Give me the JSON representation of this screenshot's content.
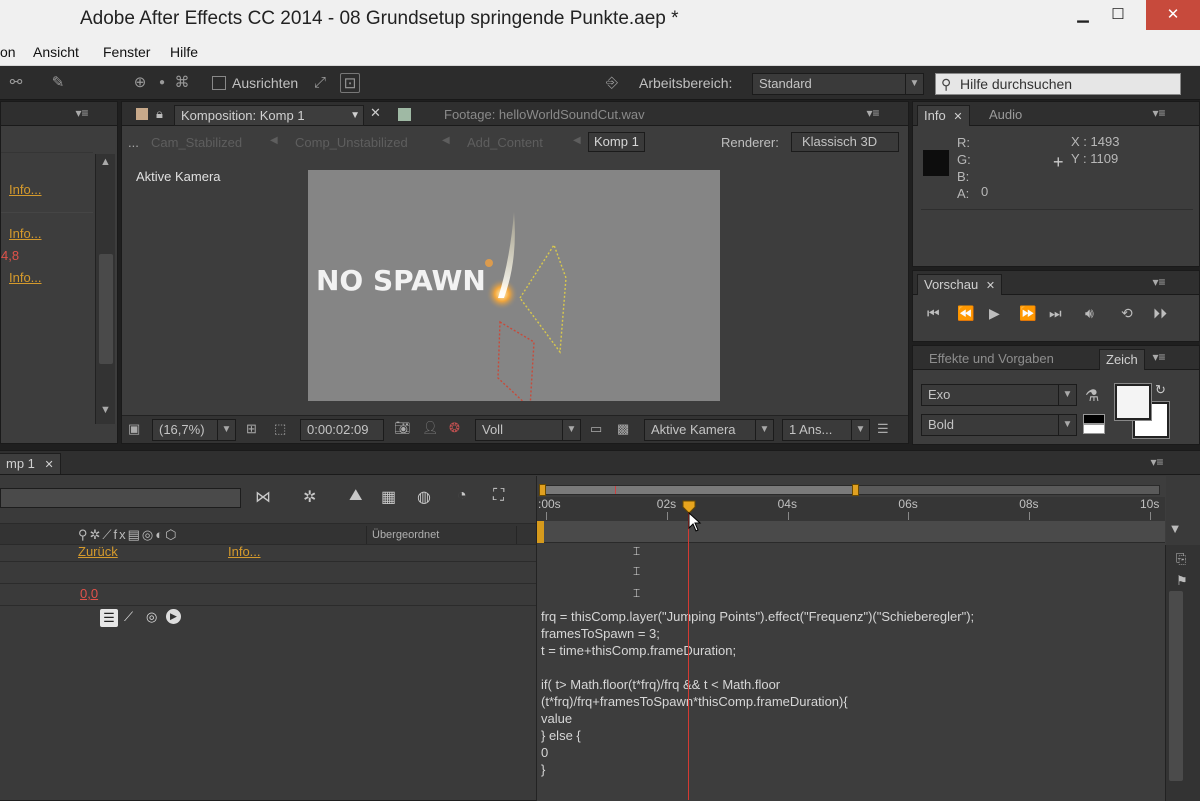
{
  "window": {
    "title": "Adobe After Effects CC 2014 - 08 Grundsetup springende Punkte.aep *",
    "minimize": "▁",
    "maximize": "☐",
    "close": "✕"
  },
  "menu": [
    "on",
    "Ansicht",
    "Fenster",
    "Hilfe"
  ],
  "toolbar": {
    "ausrichten_label": "Ausrichten",
    "workspace_label": "Arbeitsbereich:",
    "workspace_value": "Standard",
    "help_placeholder": "Hilfe durchsuchen"
  },
  "left_panel": {
    "rows": [
      "Info...",
      "Info...",
      "4,8",
      "Info..."
    ]
  },
  "composition": {
    "tab_label": "Komposition: Komp 1",
    "footage_tab": "Footage: helloWorldSoundCut.wav",
    "breadcrumbs": [
      "...",
      "Cam_Stabilized",
      "Comp_Unstabilized",
      "Add_Content",
      "Komp 1"
    ],
    "renderer_label": "Renderer:",
    "renderer_value": "Klassisch 3D",
    "camera_label": "Aktive Kamera",
    "canvas_text": "NO SPAWN",
    "zoom": "(16,7%)",
    "timecode": "0:00:02:09",
    "resolution": "Voll",
    "camera_select": "Aktive Kamera",
    "views_select": "1 Ans..."
  },
  "info_panel": {
    "tabs": [
      "Info",
      "Audio"
    ],
    "r": "R:",
    "g": "G:",
    "b": "B:",
    "a": "A:",
    "a_value": "0",
    "x": "X : 1493",
    "y": "Y : 1109"
  },
  "preview_panel": {
    "tab": "Vorschau"
  },
  "effects_panel": {
    "tabs": [
      "Effekte und Vorgaben",
      "Zeich"
    ],
    "font": "Exo",
    "style": "Bold"
  },
  "timeline": {
    "tab": "mp 1",
    "ticks": [
      ":00s",
      "02s",
      "04s",
      "06s",
      "08s",
      "10s"
    ],
    "parent_header": "Übergeordnet",
    "rows": {
      "zuruck": "Zurück",
      "info": "Info...",
      "value": "0,0"
    },
    "playhead_time_s": 2.375,
    "expression": [
      "frq = thisComp.layer(\"Jumping Points\").effect(\"Frequenz\")(\"Schieberegler\");",
      "framesToSpawn = 3;",
      "t = time+thisComp.frameDuration;",
      "",
      "if( t> Math.floor(t*frq)/frq && t < Math.floor",
      "(t*frq)/frq+framesToSpawn*thisComp.frameDuration){",
      "value",
      "} else {",
      "0",
      "}"
    ]
  }
}
